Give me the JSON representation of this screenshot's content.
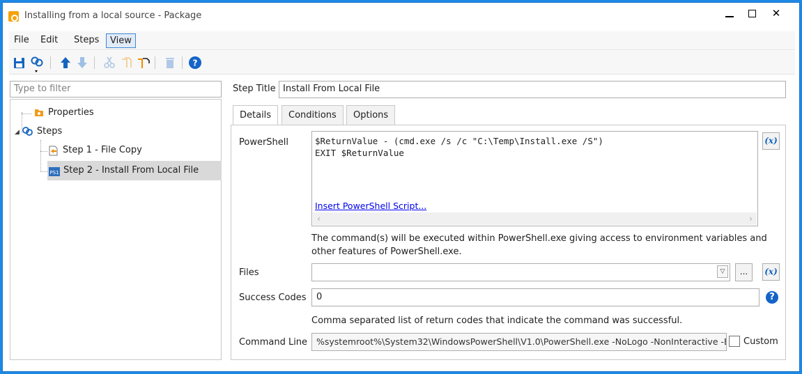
{
  "window": {
    "title": "Installing from a local source - Package",
    "controls": {
      "minimize": "–",
      "maximize": "□",
      "close": "✕"
    }
  },
  "menu": {
    "items": [
      {
        "label": "File"
      },
      {
        "label": "Edit"
      },
      {
        "label": "Steps"
      },
      {
        "label": "View",
        "active": true
      }
    ]
  },
  "toolbar": {
    "buttons": [
      {
        "name": "save-icon",
        "enabled": true
      },
      {
        "name": "add-step-icon",
        "enabled": true
      },
      {
        "name": "move-up-icon",
        "enabled": true
      },
      {
        "name": "move-down-icon",
        "enabled": false
      },
      {
        "name": "cut-icon",
        "enabled": false
      },
      {
        "name": "copy-icon",
        "enabled": false
      },
      {
        "name": "paste-icon",
        "enabled": true
      },
      {
        "name": "delete-icon",
        "enabled": false
      },
      {
        "name": "help-icon",
        "enabled": true
      }
    ]
  },
  "sidebar": {
    "filter_placeholder": "Type to filter",
    "tree": {
      "properties_label": "Properties",
      "steps_label": "Steps",
      "steps": [
        {
          "label": "Step 1 - File Copy",
          "icon": "file-copy-icon"
        },
        {
          "label": "Step 2 - Install From Local File",
          "icon": "powershell-icon",
          "selected": true
        }
      ]
    }
  },
  "editor": {
    "step_title_label": "Step Title",
    "step_title_value": "Install From Local File",
    "tabs": [
      {
        "label": "Details",
        "active": true
      },
      {
        "label": "Conditions"
      },
      {
        "label": "Options"
      }
    ],
    "powershell_label": "PowerShell",
    "powershell_code": "$ReturnValue - (cmd.exe /s /c \"C:\\Temp\\Install.exe /S\")\nEXIT $ReturnValue",
    "insert_script_link": "Insert PowerShell Script...",
    "variable_button": "(x)",
    "powershell_hint": "The command(s) will be executed within PowerShell.exe giving access to environment variables and other features of PowerShell.exe.",
    "files_label": "Files",
    "files_value": "",
    "browse_button": "...",
    "success_codes_label": "Success Codes",
    "success_codes_value": "0",
    "success_codes_hint": "Comma separated list of return codes that indicate the command was successful.",
    "help_button": "?",
    "command_line_label": "Command Line",
    "command_line_value": "%systemroot%\\System32\\WindowsPowerShell\\V1.0\\PowerShell.exe -NoLogo -NonInteractive -ExecutionPolicy Bypass",
    "custom_label": "Custom",
    "custom_checked": false
  },
  "colors": {
    "accent": "#1e88e5",
    "link": "#0000ee",
    "selected_row": "#d9d9d9",
    "help_blue": "#1464c8"
  }
}
